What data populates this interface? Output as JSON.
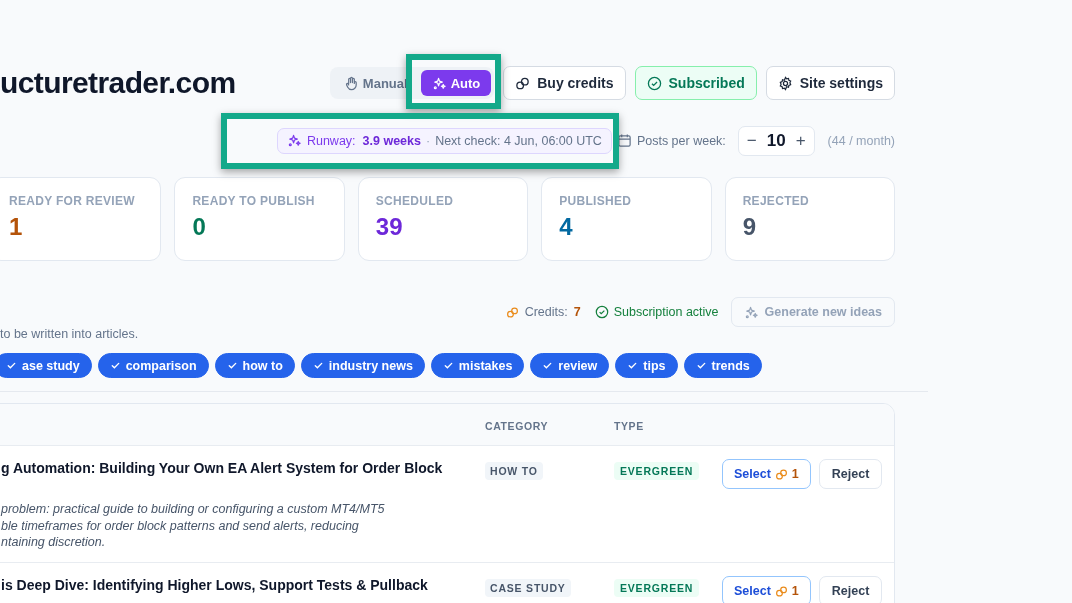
{
  "site": {
    "title": "ucturetrader.com"
  },
  "mode_toggle": [
    {
      "label": "Manual",
      "selected": false
    },
    {
      "label": "Auto",
      "selected": true
    }
  ],
  "header_buttons": [
    {
      "kind": "buy",
      "label": "Buy credits"
    },
    {
      "kind": "subscribed",
      "label": "Subscribed"
    },
    {
      "kind": "settings",
      "label": "Site settings"
    }
  ],
  "runway": {
    "label": "Runway:",
    "value": "3.9 weeks",
    "separator": "·",
    "next_check": "Next check: 4 Jun, 06:00 UTC"
  },
  "posts_per_week": {
    "label": "Posts per week:",
    "minus": "−",
    "value": "10",
    "plus": "+",
    "monthly": "(44 / month)"
  },
  "stats": [
    {
      "label": "READY FOR REVIEW",
      "value": "1",
      "color": "#b45309"
    },
    {
      "label": "READY TO PUBLISH",
      "value": "0",
      "color": "#047857"
    },
    {
      "label": "SCHEDULED",
      "value": "39",
      "color": "#6d28d9"
    },
    {
      "label": "PUBLISHED",
      "value": "4",
      "color": "#0369a1"
    },
    {
      "label": "REJECTED",
      "value": "9",
      "color": "#475569"
    }
  ],
  "credits": {
    "label": "Credits:",
    "value": "7"
  },
  "subscription_status": "Subscription active",
  "generate_button": {
    "label": "Generate new ideas",
    "disabled": true
  },
  "intro_text": "to be written into articles.",
  "filters": [
    {
      "label": "ase study",
      "checked": true
    },
    {
      "label": "comparison",
      "checked": true
    },
    {
      "label": "how to",
      "checked": true
    },
    {
      "label": "industry news",
      "checked": true
    },
    {
      "label": "mistakes",
      "checked": true
    },
    {
      "label": "review",
      "checked": true
    },
    {
      "label": "tips",
      "checked": true
    },
    {
      "label": "trends",
      "checked": true
    }
  ],
  "table": {
    "columns": [
      "CATEGORY",
      "TYPE"
    ],
    "rows": [
      {
        "title": "g Automation: Building Your Own EA Alert System for Order Block",
        "description_lines": [
          "problem: practical guide to building or configuring a custom MT4/MT5",
          "ble timeframes for order block patterns and send alerts, reducing",
          "ntaining discretion."
        ],
        "category": "HOW TO",
        "type": "EVERGREEN",
        "select": "Select",
        "cost": "1",
        "reject": "Reject"
      },
      {
        "title": "is Deep Dive: Identifying Higher Lows, Support Tests & Pullback",
        "description_lines": [],
        "category": "CASE STUDY",
        "type": "EVERGREEN",
        "select": "Select",
        "cost": "1",
        "reject": "Reject"
      }
    ]
  }
}
